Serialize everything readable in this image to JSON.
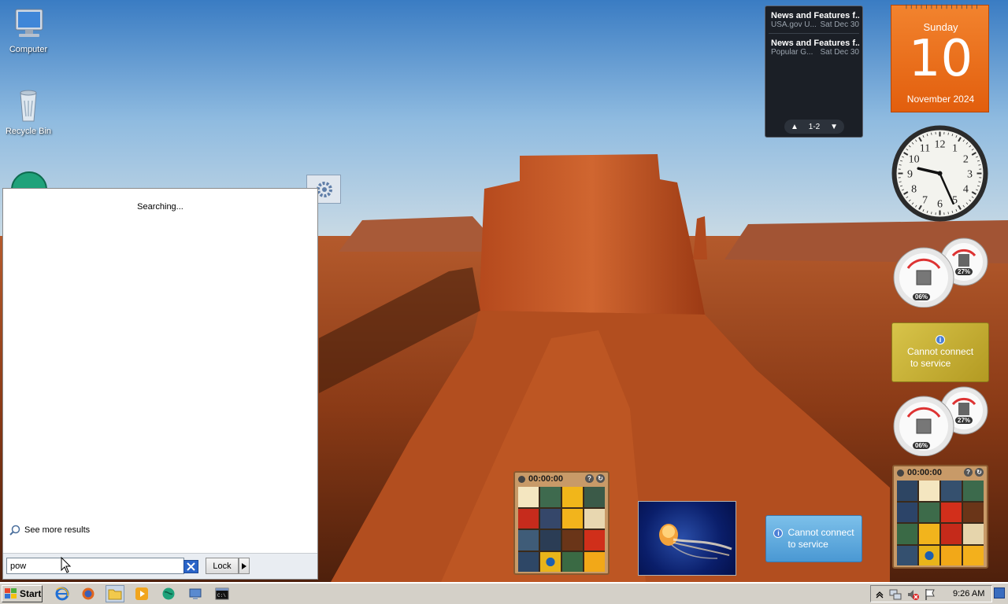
{
  "desktop": {
    "icons": [
      {
        "label": "Computer",
        "icon": "computer-icon"
      },
      {
        "label": "Recycle Bin",
        "icon": "recycle-bin-icon"
      }
    ]
  },
  "start_menu": {
    "status_text": "Searching...",
    "see_more_label": "See more results",
    "search": {
      "value": "pow"
    },
    "lock_label": "Lock"
  },
  "taskbar": {
    "start_label": "Start",
    "quick_launch": [
      "internet-explorer-icon",
      "firefox-icon",
      "windows-explorer-icon",
      "media-player-icon",
      "globe-app-icon",
      "remote-desktop-icon",
      "command-prompt-icon"
    ],
    "tray_icons": [
      "show-hidden-icons-chevron",
      "network-icon",
      "volume-muted-icon",
      "action-center-flag-icon"
    ],
    "clock": "9:26 AM"
  },
  "gadgets": {
    "feed": {
      "items": [
        {
          "title": "News and Features f...",
          "source": "USA.gov U...",
          "date": "Sat Dec 30"
        },
        {
          "title": "News and Features f...",
          "source": "Popular G...",
          "date": "Sat Dec 30"
        }
      ],
      "page_indicator": "1-2"
    },
    "calendar": {
      "weekday": "Sunday",
      "day": "10",
      "month_year": "November 2024"
    },
    "clock": {
      "hour": 9,
      "minute": 26
    },
    "cpu_meters": [
      {
        "cpu": "06%",
        "memory": "27%"
      },
      {
        "cpu": "06%",
        "memory": "27%"
      }
    ],
    "weather": [
      {
        "line1": "Cannot connect",
        "line2": "to service"
      },
      {
        "line1": "Cannot connect",
        "line2": "to service"
      }
    ],
    "puzzles": [
      {
        "timer": "00:00:00"
      },
      {
        "timer": "00:00:00"
      }
    ]
  },
  "colors": {
    "calendar_orange": "#e8680f",
    "taskbar_gray": "#d4d0c8",
    "feed_dark": "#1b1f26",
    "weather_gold": "#c9b332",
    "weather_blue": "#5aa7dc"
  }
}
